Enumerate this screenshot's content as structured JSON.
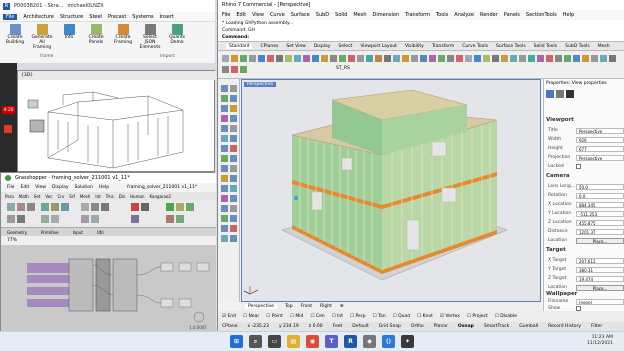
{
  "revit": {
    "title": "P00038201 - Skra...",
    "user": "michael0LNZX",
    "menu": [
      "File",
      "Architecture",
      "Structure",
      "Steel",
      "Precast",
      "Systems",
      "Insert"
    ],
    "ribbon_buttons": [
      "Create Building",
      "Generate All Framing",
      "Info",
      "Create Panels",
      "Create Framing",
      "Select JSON Elements",
      "Quants Demo"
    ],
    "panel_frame": "frame",
    "panel_import": "import",
    "view_tab": "{3D}",
    "time_badge": "4:20"
  },
  "grasshopper": {
    "title": "Grasshopper - framing_solver_211001 v1_11*",
    "doc_name": "framing_solver_211001 v1_11*",
    "menu": [
      "File",
      "Edit",
      "View",
      "Display",
      "Solution",
      "Help"
    ],
    "tabs": [
      "Para",
      "Math",
      "Set",
      "Vec",
      "Crv",
      "Srf",
      "Mesh",
      "Int",
      "Trns",
      "Dis",
      "Human",
      "Kangaroo2"
    ],
    "categories": [
      "Geometry",
      "Primitive",
      "Input",
      "Util"
    ],
    "zoom": "77%",
    "version": "1.0.0007"
  },
  "rhino": {
    "title": "Rhino 7 Commercial - [Perspective]",
    "menu": [
      "File",
      "Edit",
      "View",
      "Curve",
      "Surface",
      "SubD",
      "Solid",
      "Mesh",
      "Dimension",
      "Transform",
      "Tools",
      "Analyze",
      "Render",
      "Panels",
      "SectionTools",
      "Help"
    ],
    "command_lines": [
      "* Loading GhPython assembly...",
      "Command: GH",
      "Command:"
    ],
    "toolbar_tabs": [
      "Standard",
      "CPlanes",
      "Set View",
      "Display",
      "Select",
      "Viewport Layout",
      "Visibility",
      "Transform",
      "Curve Tools",
      "Surface Tools",
      "Solid Tools",
      "SubD Tools",
      "Mesh"
    ],
    "layer_text": "ST_RS",
    "viewport_name": "Perspective",
    "view_tabs": [
      "Perspective",
      "Top",
      "Front",
      "Right"
    ],
    "osnaps": [
      "End",
      "Near",
      "Point",
      "Mid",
      "Cen",
      "Int",
      "Perp",
      "Tan",
      "Quad",
      "Knot",
      "Vertex",
      "Project",
      "Disable"
    ],
    "status": {
      "cplane": "CPlane",
      "x": "x -235.23",
      "y": "y 234.19",
      "z": "z 0.00",
      "units": "Feet",
      "layer": "Default",
      "toggles": [
        "Grid Snap",
        "Ortho",
        "Planar",
        "Osnap",
        "SmartTrack",
        "Gumball",
        "Record History",
        "Filter"
      ]
    }
  },
  "properties": {
    "title": "Properties: View properties",
    "viewport_section": "Viewport",
    "title_label": "Title",
    "title_value": "Perspective",
    "width_label": "Width",
    "width_value": "926",
    "height_label": "Height",
    "height_value": "677",
    "projection_label": "Projection",
    "projection_value": "Perspective",
    "locked_label": "Locked",
    "camera_section": "Camera",
    "lens_label": "Lens Leng...",
    "lens_value": "50.0",
    "rotation_label": "Rotation",
    "rotation_value": "0.0",
    "xloc_label": "X Location",
    "xloc_value": "884.345",
    "yloc_label": "Y Location",
    "yloc_value": "-511.253",
    "zloc_label": "Z Location",
    "zloc_value": "455.875",
    "dist_label": "Distance",
    "dist_value": "1201.37",
    "location_label": "Location",
    "place_label": "Place...",
    "target_section": "Target",
    "xt_label": "X Target",
    "xt_value": "207.612",
    "yt_label": "Y Target",
    "yt_value": "380.31",
    "zt_label": "Z Target",
    "zt_value": "19.474",
    "wallpaper_section": "Wallpaper",
    "filename_label": "Filename",
    "filename_value": "(none)",
    "show_label": "Show"
  },
  "taskbar": {
    "time": "11:23 AM",
    "date": "11/12/2021"
  }
}
